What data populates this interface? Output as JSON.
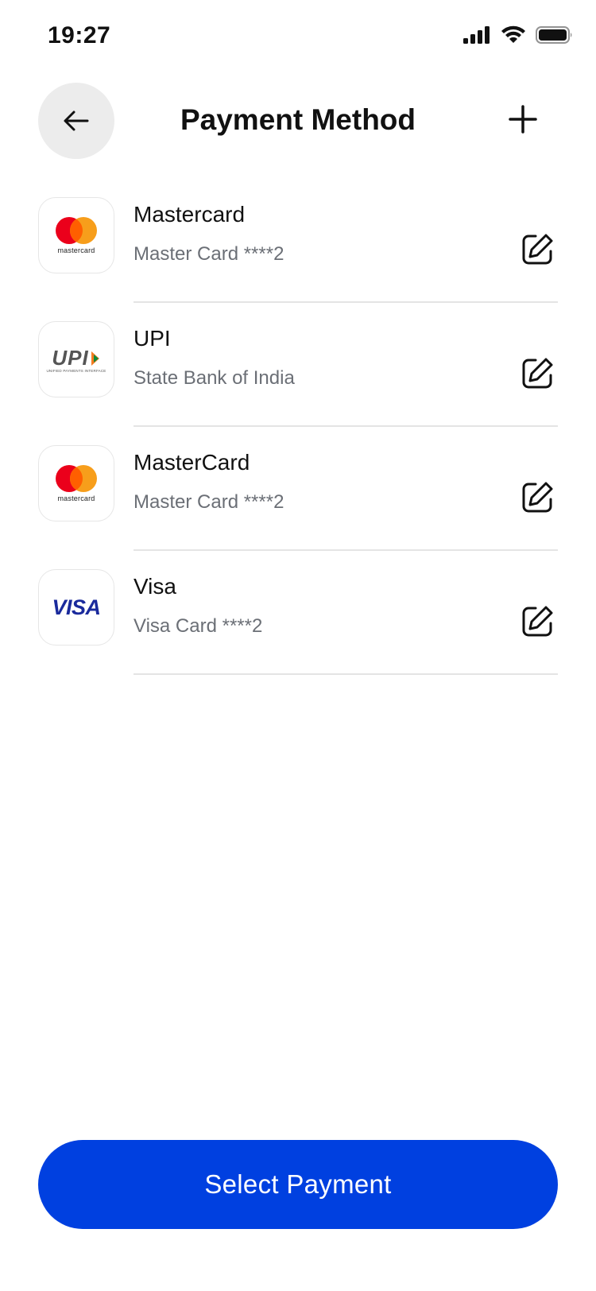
{
  "status_bar": {
    "time": "19:27",
    "icons": [
      "signal-icon",
      "wifi-icon",
      "battery-icon"
    ]
  },
  "header": {
    "title": "Payment Method",
    "back_icon": "arrow-left-icon",
    "add_icon": "plus-icon"
  },
  "methods": [
    {
      "name": "Mastercard",
      "detail": "Master Card ****2",
      "logo": "mastercard-logo",
      "logo_text": "mastercard"
    },
    {
      "name": "UPI",
      "detail": "State Bank of India",
      "logo": "upi-logo",
      "logo_text": "UPI",
      "logo_subtext": "UNIFIED PAYMENTS INTERFACE"
    },
    {
      "name": "MasterCard",
      "detail": "Master Card ****2",
      "logo": "mastercard-logo",
      "logo_text": "mastercard"
    },
    {
      "name": "Visa",
      "detail": "Visa Card ****2",
      "logo": "visa-logo",
      "logo_text": "VISA"
    }
  ],
  "footer": {
    "select_label": "Select Payment"
  },
  "colors": {
    "primary": "#0040e0",
    "mc_red": "#eb001b",
    "mc_orange": "#f79e1b",
    "visa_blue": "#1a2a9c",
    "muted_text": "#6b6f76"
  }
}
